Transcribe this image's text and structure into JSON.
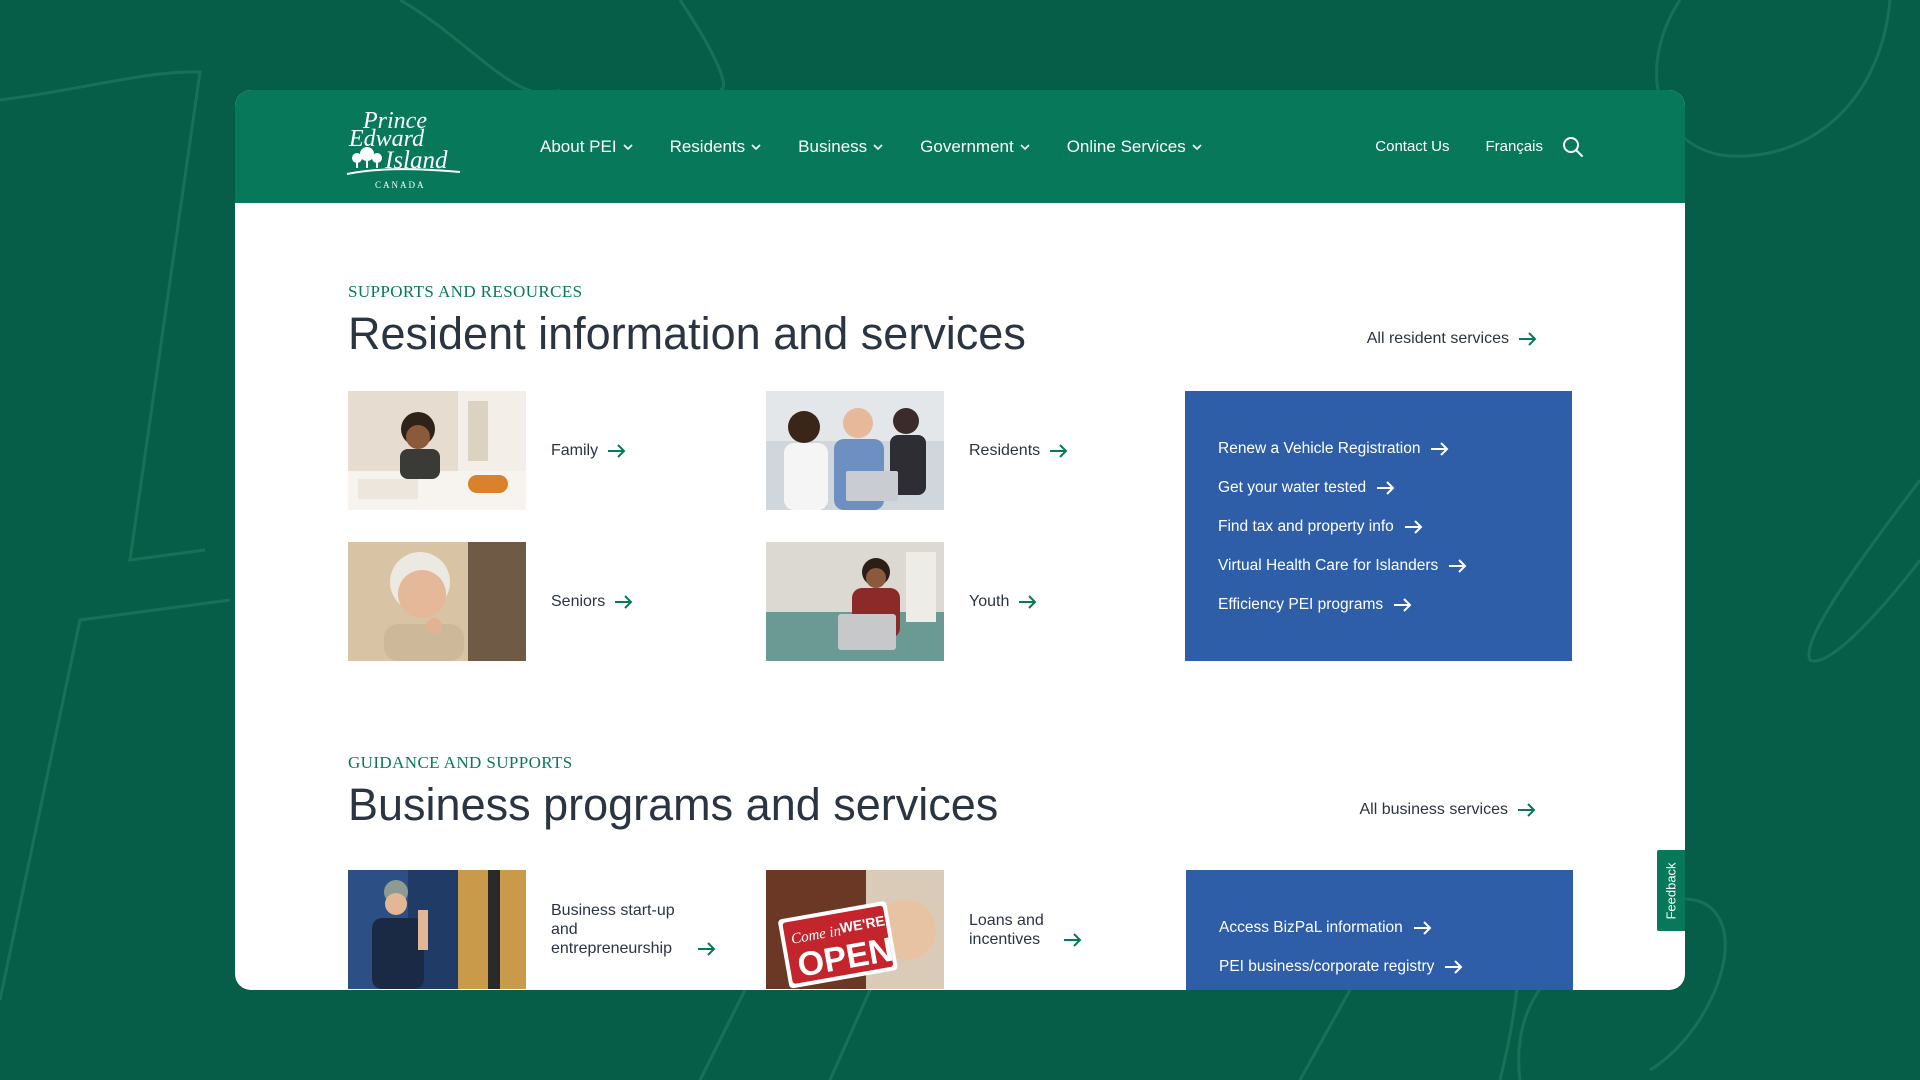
{
  "colors": {
    "background": "#075e48",
    "header": "#07795a",
    "accent_green": "#07795a",
    "panel_blue": "#2e5ea8",
    "heading_text": "#2b3441"
  },
  "header": {
    "logo": {
      "line1": "Prince",
      "line2": "Edward",
      "line3": "Island",
      "line4": "CANADA"
    },
    "nav": [
      {
        "label": "About PEI",
        "icon": "chevron-down-icon"
      },
      {
        "label": "Residents",
        "icon": "chevron-down-icon"
      },
      {
        "label": "Business",
        "icon": "chevron-down-icon"
      },
      {
        "label": "Government",
        "icon": "chevron-down-icon"
      },
      {
        "label": "Online Services",
        "icon": "chevron-down-icon"
      }
    ],
    "contact_label": "Contact Us",
    "language_label": "Français",
    "search_icon": "search-icon"
  },
  "residents_section": {
    "eyebrow": "SUPPORTS AND RESOURCES",
    "title": "Resident information and services",
    "all_link": "All resident services",
    "cards": [
      {
        "label": "Family",
        "image": "child-drawing-photo"
      },
      {
        "label": "Residents",
        "image": "people-at-laptop-photo"
      },
      {
        "label": "Seniors",
        "image": "senior-woman-photo"
      },
      {
        "label": "Youth",
        "image": "youth-with-laptop-photo"
      }
    ],
    "quick_links": [
      "Renew a Vehicle Registration",
      "Get your water tested",
      "Find tax and property info",
      "Virtual Health Care for Islanders",
      "Efficiency PEI programs"
    ]
  },
  "business_section": {
    "eyebrow": "GUIDANCE AND SUPPORTS",
    "title": "Business programs and services",
    "all_link": "All business services",
    "cards": [
      {
        "label": "Business start-up and entrepreneurship",
        "image": "worker-photo"
      },
      {
        "label": "Loans and incentives",
        "image": "open-sign-photo",
        "sign_small": "Come in",
        "sign_top": "WE'RE",
        "sign_big": "OPEN"
      }
    ],
    "quick_links": [
      "Access BizPaL information",
      "PEI business/corporate registry"
    ]
  },
  "feedback_label": "Feedback"
}
